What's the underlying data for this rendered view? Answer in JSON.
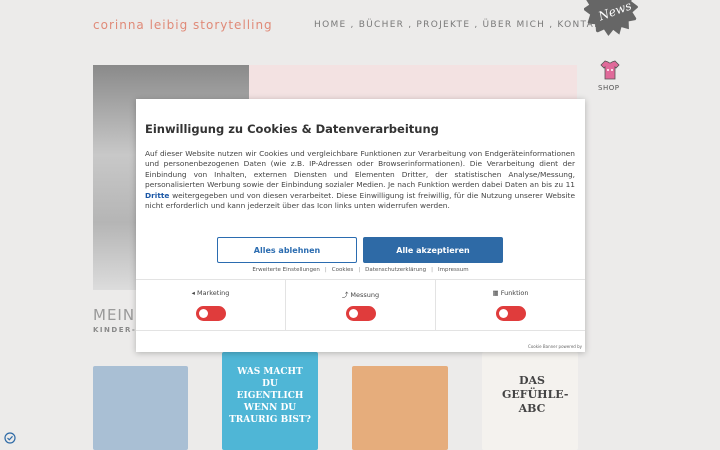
{
  "site": {
    "logo": "corinna leibig storytelling",
    "nav": [
      "HOME",
      ",",
      "BÜCHER",
      ",",
      "PROJEKTE",
      ",",
      "ÜBER MICH",
      ",",
      "KONTAKT"
    ],
    "news_badge": "News",
    "shop_label": "SHOP"
  },
  "section": {
    "title": "MEINE",
    "subtitle": "KINDER-"
  },
  "books": [
    {
      "title": ""
    },
    {
      "title": "WAS MACHT DU EIGENTLICH WENN DU TRAURIG BIST?"
    },
    {
      "title": ""
    },
    {
      "title": "DAS GEFÜHLE-ABC"
    }
  ],
  "cookie_modal": {
    "title": "Einwilligung zu Cookies & Datenverarbeitung",
    "text_before": "Auf dieser Website nutzen wir Cookies und vergleichbare Funktionen zur Verarbeitung von Endgeräteinformationen und personenbezogenen Daten (wie z.B. IP-Adressen oder Browserinformationen). Die Verarbeitung dient der Einbindung von Inhalten, externen Diensten und Elementen Dritter, der statistischen Analyse/Messung, personalisierten Werbung sowie der Einbindung sozialer Medien. Je nach Funktion werden dabei Daten an bis zu 11",
    "text_link": "Dritte",
    "text_after": "weitergegeben und von diesen verarbeitet. Diese Einwilligung ist freiwillig, für die Nutzung unserer Website nicht erforderlich und kann jederzeit über das Icon links unten widerrufen werden.",
    "reject_label": "Alles ablehnen",
    "accept_label": "Alle akzeptieren",
    "links": [
      "Erweiterte Einstellungen",
      "Cookies",
      "Datenschutzerklärung",
      "Impressum"
    ],
    "toggles": [
      {
        "label": "Marketing",
        "icon": "megaphone-icon",
        "enabled": false
      },
      {
        "label": "Messung",
        "icon": "chart-icon",
        "enabled": false
      },
      {
        "label": "Funktion",
        "icon": "grid-icon",
        "enabled": false
      }
    ],
    "powered_by": "Cookie Banner powered by"
  },
  "colors": {
    "accent_blue": "#2e6aa6",
    "toggle_off_red": "#e03c3c",
    "logo_salmon": "#e08a78"
  }
}
